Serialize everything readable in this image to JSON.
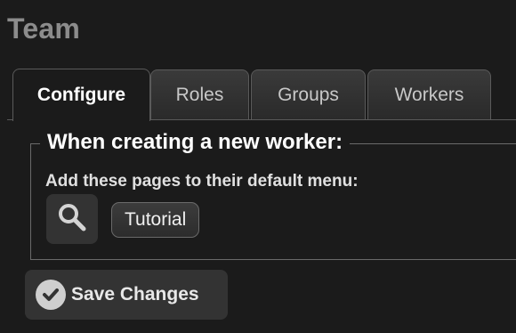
{
  "page": {
    "title": "Team"
  },
  "tabs": [
    {
      "label": "Configure",
      "active": true
    },
    {
      "label": "Roles",
      "active": false
    },
    {
      "label": "Groups",
      "active": false
    },
    {
      "label": "Workers",
      "active": false
    }
  ],
  "panel": {
    "legend": "When creating a new worker:",
    "description": "Add these pages to their default menu:",
    "search_icon": "magnifier-icon",
    "menu_items": [
      {
        "label": "Tutorial"
      }
    ]
  },
  "actions": {
    "save_label": "Save Changes",
    "save_icon": "check-circle-icon"
  },
  "colors": {
    "background": "#1b1b1b",
    "title": "#8c8c8c",
    "control_bg": "#333333",
    "border": "#5a5a5a"
  }
}
